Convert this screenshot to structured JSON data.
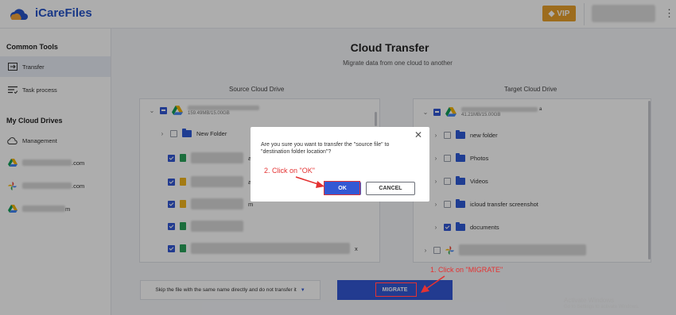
{
  "app": {
    "title": "iCareFiles",
    "vip_label": "VIP"
  },
  "sidebar": {
    "common_tools_title": "Common Tools",
    "tools": [
      {
        "label": "Transfer",
        "icon": "transfer-icon"
      },
      {
        "label": "Task process",
        "icon": "task-list-icon"
      }
    ],
    "cloud_drives_title": "My Cloud Drives",
    "drives": [
      {
        "label": "Management",
        "icon": "cloud-icon"
      },
      {
        "label_suffix": ".com",
        "icon": "google-drive-icon"
      },
      {
        "label_suffix": ".com",
        "icon": "google-photos-icon"
      },
      {
        "label_suffix": "m",
        "icon": "google-drive-icon"
      }
    ]
  },
  "main": {
    "title": "Cloud Transfer",
    "subtitle": "Migrate data from one cloud to another",
    "source_label": "Source Cloud Drive",
    "target_label": "Target Cloud Drive"
  },
  "source": {
    "root_size": "159.49MB/15.00GB",
    "folder": "New Folder",
    "file_suffixes": [
      "a",
      "a",
      "m",
      "",
      "x"
    ]
  },
  "target": {
    "root_size": "41.21MB/15.00GB",
    "root_suffix": "a",
    "folders": [
      "new folder",
      "Photos",
      "Videos",
      "icloud transfer screenshot",
      "documents"
    ]
  },
  "dialog": {
    "message": "Are you sure you want to transfer the \"source file\" to \"destination folder location\"?",
    "ok": "OK",
    "cancel": "CANCEL"
  },
  "bottom": {
    "skip_option": "Skip the file with the same name directly and do not transfer it",
    "migrate": "MIGRATE"
  },
  "annotations": {
    "step1": "1. Click on \"MIGRATE\"",
    "step2": "2. Click on \"OK\"",
    "color": "#e43232"
  },
  "watermark": {
    "line1": "Activate Windows",
    "line2": "Go to Settings to activate Windows."
  },
  "colors": {
    "accent": "#3358d4",
    "brand": "#2553c7",
    "vip": "#e8a02b"
  }
}
